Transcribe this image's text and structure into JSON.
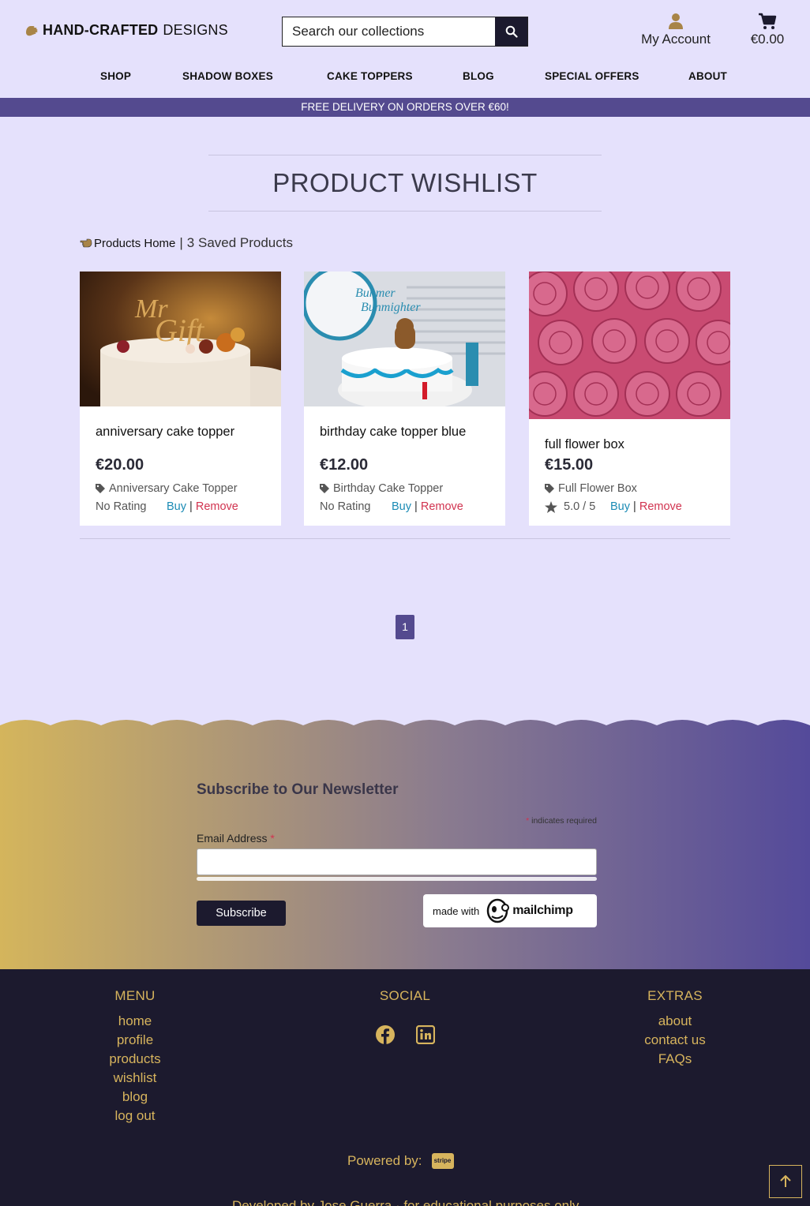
{
  "header": {
    "logo_bold": "HAND-CRAFTED",
    "logo_thin": "DESIGNS",
    "search_placeholder": "Search our collections",
    "account_label": "My Account",
    "cart_total": "€0.00"
  },
  "nav": [
    "SHOP",
    "SHADOW BOXES",
    "CAKE TOPPERS",
    "BLOG",
    "SPECIAL OFFERS",
    "ABOUT"
  ],
  "banner": "FREE DELIVERY ON ORDERS OVER €60!",
  "page_title": "PRODUCT WISHLIST",
  "breadcrumb": {
    "home": "Products Home",
    "separator": "|",
    "count": "3 Saved Products"
  },
  "products": [
    {
      "name": "anniversary cake topper",
      "price": "€20.00",
      "category": "Anniversary Cake Topper",
      "rating": "No Rating",
      "buy": "Buy",
      "sep": "|",
      "remove": "Remove"
    },
    {
      "name": "birthday cake topper blue",
      "price": "€12.00",
      "category": "Birthday Cake Topper",
      "rating": "No Rating",
      "buy": "Buy",
      "sep": "|",
      "remove": "Remove"
    },
    {
      "name": "full flower box",
      "price": "€15.00",
      "category": "Full Flower Box",
      "rating": "5.0 / 5",
      "buy": "Buy",
      "sep": "|",
      "remove": "Remove"
    }
  ],
  "pagination": {
    "current": "1"
  },
  "newsletter": {
    "title": "Subscribe to Our Newsletter",
    "required_star": "*",
    "required_note": "indicates required",
    "email_label": "Email Address",
    "subscribe": "Subscribe",
    "made_with": "made with",
    "mailchimp": "mailchimp"
  },
  "footer": {
    "menu_title": "MENU",
    "menu": [
      "home",
      "profile",
      "products",
      "wishlist",
      "blog",
      "log out"
    ],
    "social_title": "SOCIAL",
    "extras_title": "EXTRAS",
    "extras": [
      "about",
      "contact us",
      "FAQs"
    ],
    "powered_by": "Powered by:",
    "stripe": "stripe",
    "developed": "Developed by Jose Guerra  ·  for educational purposes only"
  },
  "colors": {
    "accent": "#544a8f",
    "page_bg": "#e5e1fc",
    "footer_bg": "#1c1a2e",
    "gold": "#d7b45d",
    "buy": "#1b8bb5",
    "remove": "#d1334f"
  }
}
